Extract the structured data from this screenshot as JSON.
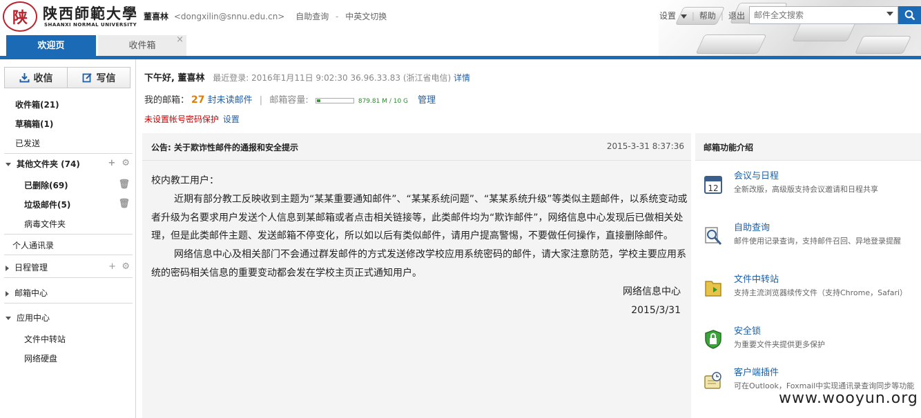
{
  "header": {
    "logo_cn": "陕西師範大學",
    "logo_en": "SHAANXI NORMAL UNIVERSITY",
    "user_name": "董喜林",
    "user_email": "<dongxilin@snnu.edu.cn>",
    "link_selfquery": "自助查询",
    "link_separator": "-",
    "link_lang": "中英文切换",
    "settings": "设置",
    "help": "帮助",
    "logout": "退出",
    "search_placeholder": "邮件全文搜索"
  },
  "tabs": [
    {
      "label": "欢迎页",
      "active": true
    },
    {
      "label": "收件箱",
      "active": false,
      "close": "×"
    }
  ],
  "sidebar": {
    "receive_label": "收信",
    "compose_label": "写信",
    "folders": [
      {
        "label": "收件箱(21)",
        "bold": true
      },
      {
        "label": "草稿箱(1)",
        "bold": true
      },
      {
        "label": "已发送",
        "bold": false
      },
      {
        "label": "其他文件夹 (74)",
        "bold": true
      },
      {
        "label": "已删除(69)",
        "bold": true
      },
      {
        "label": "垃圾邮件(5)",
        "bold": true
      },
      {
        "label": "病毒文件夹",
        "bold": false
      },
      {
        "label": "个人通讯录",
        "bold": false
      },
      {
        "label": "日程管理",
        "bold": false
      },
      {
        "label": "邮箱中心",
        "bold": false
      },
      {
        "label": "应用中心",
        "bold": false
      },
      {
        "label": "文件中转站",
        "bold": false
      },
      {
        "label": "网络硬盘",
        "bold": false
      }
    ]
  },
  "welcome": {
    "greeting": "下午好, 董喜林",
    "last_login": "最近登录: 2016年1月11日 9:02:30 36.96.33.83 (浙江省电信)",
    "details_link": "详情",
    "mailbox_label": "我的邮箱：",
    "unread_count": "27",
    "unread_link": "封未读邮件",
    "divider": "|",
    "capacity_label": "邮箱容量:",
    "capacity_fraction": 0.086,
    "capacity_text": "879.81 M / 10 G",
    "manage_link": "管理",
    "warning": "未设置帐号密码保护",
    "warning_link": "设置"
  },
  "notice": {
    "title": "公告: 关于欺诈性邮件的通报和安全提示",
    "date": "2015-3-31 8:37:36",
    "salutation": "校内教工用户：",
    "para1": "近期有部分教工反映收到主题为“某某重要通知邮件”、“某某系统问题”、“某某系统升级”等类似主题邮件，以系统变动或者升级为名要求用户发送个人信息到某邮箱或者点击相关链接等，此类邮件均为“欺诈邮件”，网络信息中心发现后已做相关处理，但是此类邮件主题、发送邮箱不停变化，所以如以后有类似邮件，请用户提高警惕，不要做任何操作，直接删除邮件。",
    "para2": "网络信息中心及相关部门不会通过群发邮件的方式发送修改学校应用系统密码的邮件，请大家注意防范，学校主要应用系统的密码相关信息的重要变动都会发在学校主页正式通知用户。",
    "signature": "网络信息中心",
    "sign_date": "2015/3/31"
  },
  "features": {
    "title": "邮箱功能介绍",
    "items": [
      {
        "icon": "calendar-icon",
        "title": "会议与日程",
        "desc": "全新改版，高级版支持会议邀请和日程共享"
      },
      {
        "icon": "magnifier-icon",
        "title": "自助查询",
        "desc": "邮件使用记录查询，支持邮件召回、异地登录提醒"
      },
      {
        "icon": "folder-icon",
        "title": "文件中转站",
        "desc": "支持主流浏览器续传文件（支持Chrome，Safari）"
      },
      {
        "icon": "lock-icon",
        "title": "安全锁",
        "desc": "为重要文件夹提供更多保护"
      },
      {
        "icon": "plugin-icon",
        "title": "客户端插件",
        "desc": "可在Outlook，Foxmail中实现通讯录查询同步等功能"
      }
    ]
  },
  "watermark": "www.wooyun.org"
}
